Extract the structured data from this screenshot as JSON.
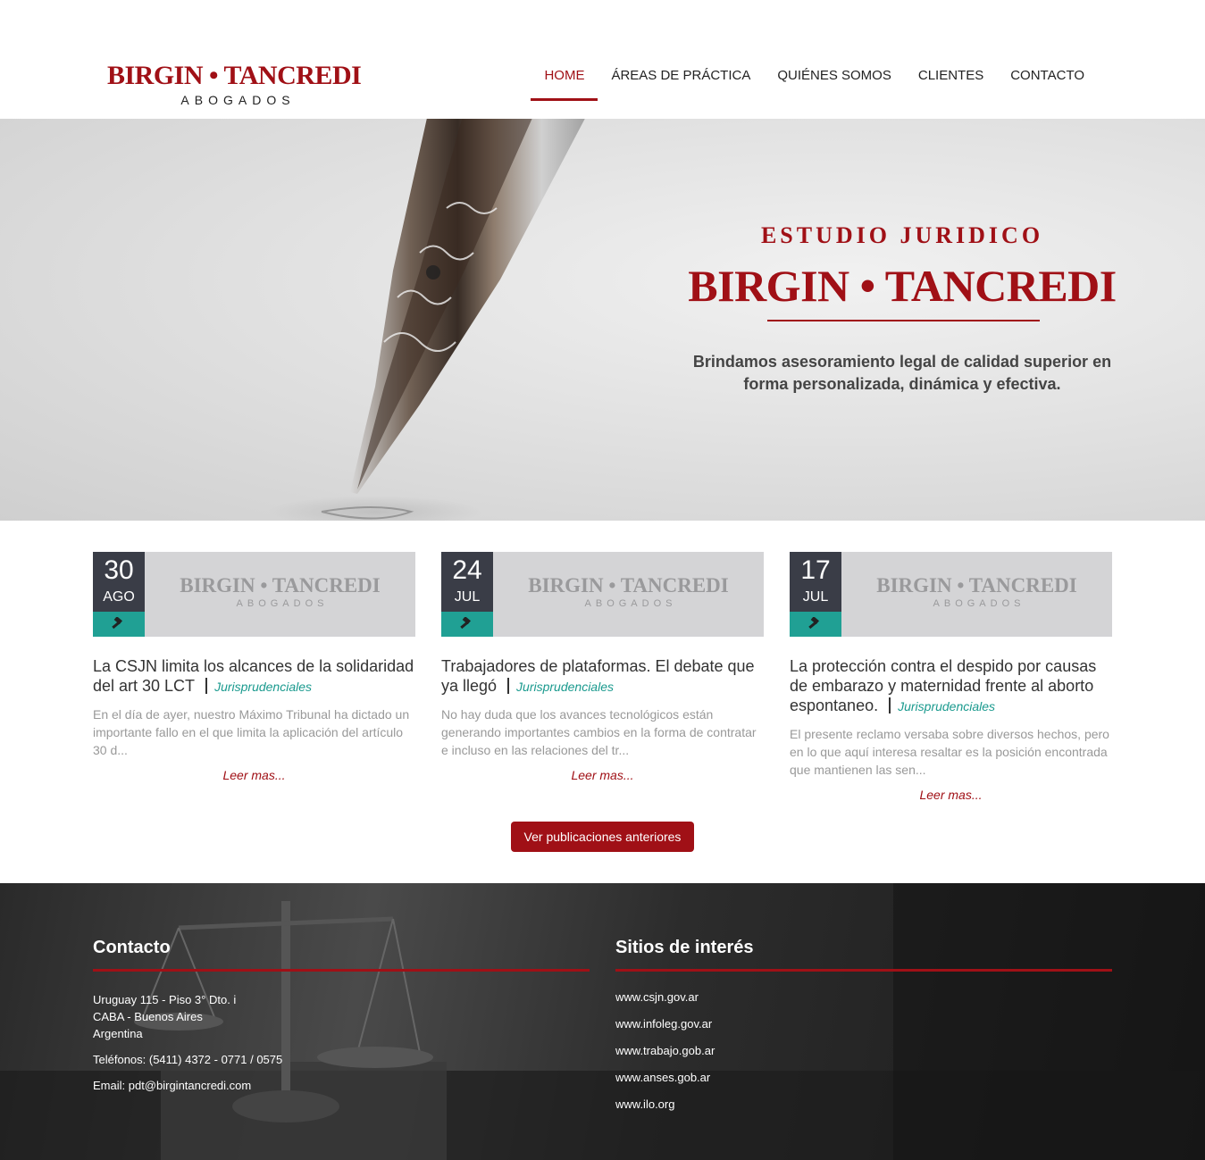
{
  "header": {
    "logo_main": "BIRGIN • TANCREDI",
    "logo_sub": "ABOGADOS",
    "nav": [
      {
        "label": "HOME",
        "active": true
      },
      {
        "label": "ÁREAS DE PRÁCTICA",
        "active": false
      },
      {
        "label": "QUIÉNES SOMOS",
        "active": false
      },
      {
        "label": "CLIENTES",
        "active": false
      },
      {
        "label": "CONTACTO",
        "active": false
      }
    ]
  },
  "hero": {
    "kicker": "ESTUDIO JURIDICO",
    "title": "BIRGIN • TANCREDI",
    "text": "Brindamos asesoramiento legal de calidad superior en forma personalizada, dinámica y efectiva."
  },
  "posts": [
    {
      "day": "30",
      "month": "AGO",
      "thumb_main": "BIRGIN • TANCREDI",
      "thumb_sub": "ABOGADOS",
      "title": "La CSJN limita los alcances de la solidaridad del art 30 LCT",
      "category": "Jurisprudenciales",
      "excerpt": "En el día de ayer, nuestro Máximo Tribunal ha dictado un importante fallo en el que limita la aplicación del artículo 30 d...",
      "more": "Leer mas..."
    },
    {
      "day": "24",
      "month": "JUL",
      "thumb_main": "BIRGIN • TANCREDI",
      "thumb_sub": "ABOGADOS",
      "title": "Trabajadores de plataformas. El debate que ya llegó",
      "category": "Jurisprudenciales",
      "excerpt": "No hay duda que los avances tecnológicos están generando importantes cambios en la forma de contratar e incluso en las relaciones del tr...",
      "more": "Leer mas..."
    },
    {
      "day": "17",
      "month": "JUL",
      "thumb_main": "BIRGIN • TANCREDI",
      "thumb_sub": "ABOGADOS",
      "title": "La protección contra el despido por causas de embarazo y maternidad frente al aborto espontaneo.",
      "category": "Jurisprudenciales",
      "excerpt": "El presente reclamo versaba sobre diversos hechos, pero en lo que aquí interesa resaltar es la posición encontrada que mantienen las sen...",
      "more": "Leer mas..."
    }
  ],
  "older_button": "Ver publicaciones anteriores",
  "footer": {
    "contact_title": "Contacto",
    "address": [
      "Uruguay 115 - Piso 3° Dto. i",
      "CABA - Buenos Aires",
      "Argentina"
    ],
    "phones": "Teléfonos: (5411) 4372 - 0771 / 0575",
    "email": "Email: pdt@birgintancredi.com",
    "sites_title": "Sitios de interés",
    "sites": [
      "www.csjn.gov.ar",
      "www.infoleg.gov.ar",
      "www.trabajo.gob.ar",
      "www.anses.gob.ar",
      "www.ilo.org"
    ]
  },
  "colors": {
    "brand_red": "#a01016",
    "teal": "#20a094",
    "date_box": "#3a3d47"
  },
  "icons": {
    "category": "gavel-icon"
  }
}
